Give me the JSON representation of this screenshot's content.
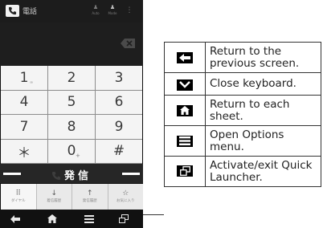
{
  "phone": {
    "app_title": "電話",
    "status_icon_labels": [
      "Auto",
      "Mode"
    ],
    "keys": [
      {
        "main": "1",
        "sub": "∞"
      },
      {
        "main": "2",
        "sub": ""
      },
      {
        "main": "3",
        "sub": ""
      },
      {
        "main": "4",
        "sub": ""
      },
      {
        "main": "5",
        "sub": ""
      },
      {
        "main": "6",
        "sub": ""
      },
      {
        "main": "7",
        "sub": ""
      },
      {
        "main": "8",
        "sub": ""
      },
      {
        "main": "9",
        "sub": ""
      },
      {
        "main": "＊",
        "sub": ""
      },
      {
        "main": "0",
        "sub": "+"
      },
      {
        "main": "#",
        "sub": ""
      }
    ],
    "call_label": "発信",
    "tabs": [
      {
        "icon": "⠿",
        "label": "ダイヤル"
      },
      {
        "icon": "↓",
        "label": "着信履歴"
      },
      {
        "icon": "↑",
        "label": "発信履歴"
      },
      {
        "icon": "☆",
        "label": "お気に入り"
      }
    ],
    "nav_icons": [
      "back-arrow-icon",
      "home-icon",
      "menu-icon",
      "quick-launcher-icon"
    ]
  },
  "legend": {
    "rows": [
      {
        "icon": "back-arrow-icon",
        "text": "Return to the previous screen."
      },
      {
        "icon": "chevron-down-icon",
        "text": "Close keyboard."
      },
      {
        "icon": "home-icon",
        "text": "Return to each sheet."
      },
      {
        "icon": "menu-icon",
        "text": "Open Options menu."
      },
      {
        "icon": "quick-launcher-icon",
        "text": "Activate/exit Quick Launcher."
      }
    ]
  }
}
